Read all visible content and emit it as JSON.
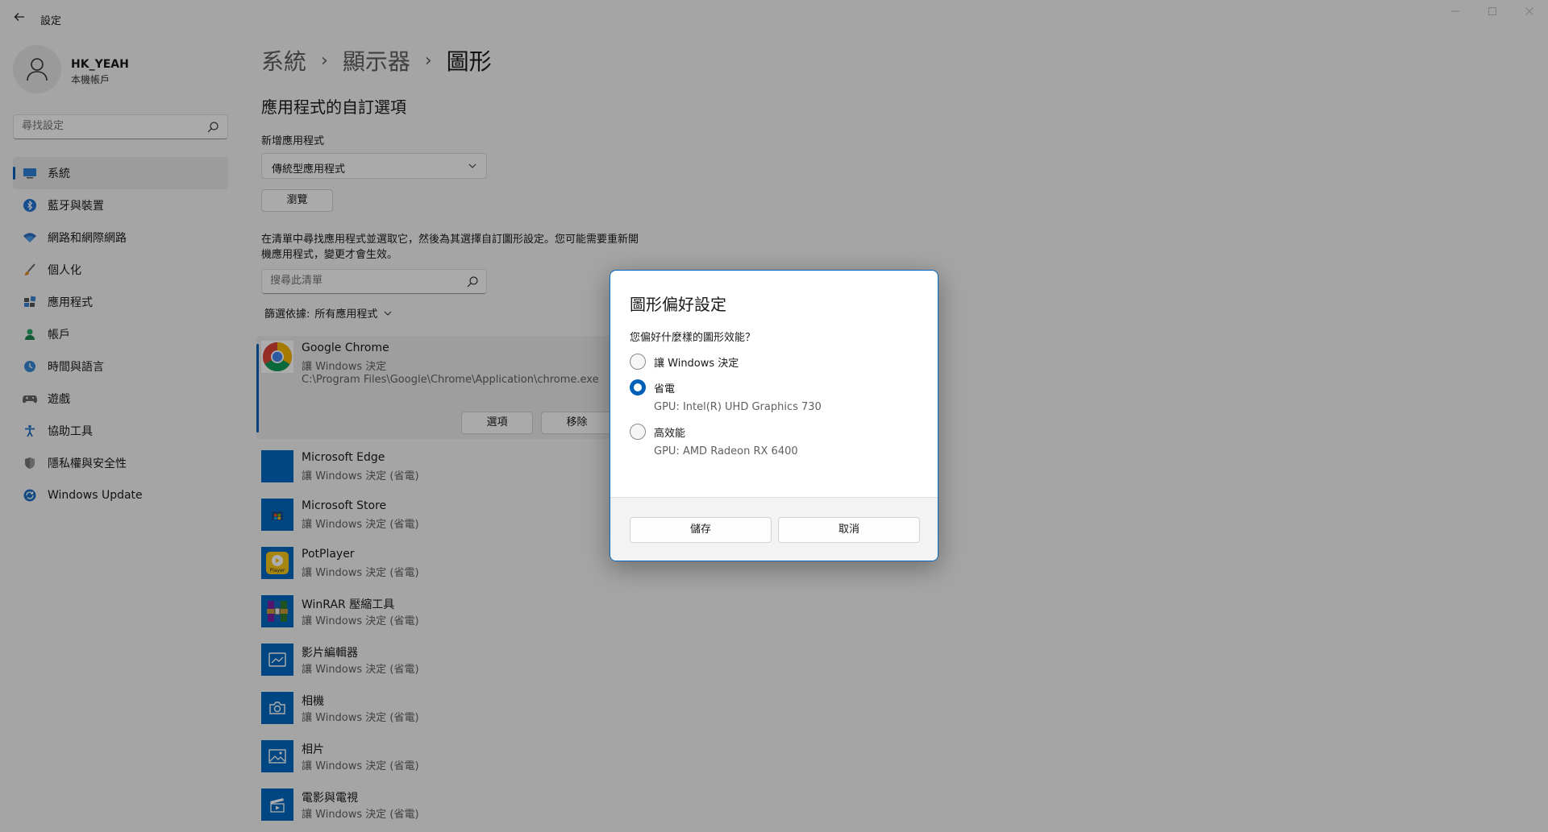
{
  "titlebar": {
    "back_icon": "back-arrow-icon",
    "title": "設定"
  },
  "profile": {
    "name": "HK_YEAH",
    "account_type": "本機帳戶"
  },
  "search": {
    "placeholder": "尋找設定"
  },
  "nav": {
    "items": [
      {
        "label": "系統",
        "icon": "system-icon",
        "active": true
      },
      {
        "label": "藍牙與裝置",
        "icon": "bluetooth-icon"
      },
      {
        "label": "網路和網際網路",
        "icon": "wifi-icon"
      },
      {
        "label": "個人化",
        "icon": "brush-icon"
      },
      {
        "label": "應用程式",
        "icon": "apps-icon"
      },
      {
        "label": "帳戶",
        "icon": "account-icon"
      },
      {
        "label": "時間與語言",
        "icon": "globe-clock-icon"
      },
      {
        "label": "遊戲",
        "icon": "gamepad-icon"
      },
      {
        "label": "協助工具",
        "icon": "accessibility-icon"
      },
      {
        "label": "隱私權與安全性",
        "icon": "shield-icon"
      },
      {
        "label": "Windows Update",
        "icon": "windows-update-icon"
      }
    ]
  },
  "breadcrumb": {
    "items": [
      "系統",
      "顯示器",
      "圖形"
    ],
    "separator": "›"
  },
  "main": {
    "section_title": "應用程式的自訂選項",
    "add_app_label": "新增應用程式",
    "app_type_selected": "傳統型應用程式",
    "browse_label": "瀏覽",
    "description": "在清單中尋找應用程式並選取它，然後為其選擇自訂圖形設定。您可能需要重新開機應用程式，變更才會生效。",
    "list_search_placeholder": "搜尋此清單",
    "filter_label": "篩選依據:",
    "filter_value": "所有應用程式"
  },
  "apps": [
    {
      "name": "Google Chrome",
      "status": "讓 Windows 決定",
      "path": "C:\\Program Files\\Google\\Chrome\\Application\\chrome.exe",
      "expanded": true,
      "options_label": "選項",
      "remove_label": "移除",
      "icon": "chrome-icon"
    },
    {
      "name": "Microsoft Edge",
      "status": "讓 Windows 決定 (省電)",
      "icon": "app-tile-icon"
    },
    {
      "name": "Microsoft Store",
      "status": "讓 Windows 決定 (省電)",
      "icon": "store-icon"
    },
    {
      "name": "PotPlayer",
      "status": "讓 Windows 決定 (省電)",
      "icon": "potplayer-icon"
    },
    {
      "name": "WinRAR 壓縮工具",
      "status": "讓 Windows 決定 (省電)",
      "icon": "winrar-icon"
    },
    {
      "name": "影片編輯器",
      "status": "讓 Windows 決定 (省電)",
      "icon": "video-editor-icon"
    },
    {
      "name": "相機",
      "status": "讓 Windows 決定 (省電)",
      "icon": "camera-icon"
    },
    {
      "name": "相片",
      "status": "讓 Windows 決定 (省電)",
      "icon": "photos-icon"
    },
    {
      "name": "電影與電視",
      "status": "讓 Windows 決定 (省電)",
      "icon": "movies-icon"
    }
  ],
  "dialog": {
    "title": "圖形偏好設定",
    "question": "您偏好什麼樣的圖形效能？",
    "options": [
      {
        "label": "讓 Windows 決定",
        "checked": false
      },
      {
        "label": "省電",
        "gpu": "GPU: Intel(R) UHD Graphics 730",
        "checked": true
      },
      {
        "label": "高效能",
        "gpu": "GPU: AMD Radeon RX 6400",
        "checked": false
      }
    ],
    "save_label": "儲存",
    "cancel_label": "取消"
  },
  "colors": {
    "accent": "#005fb8",
    "app_tile": "#0067c0",
    "background": "#f3f3f3"
  }
}
